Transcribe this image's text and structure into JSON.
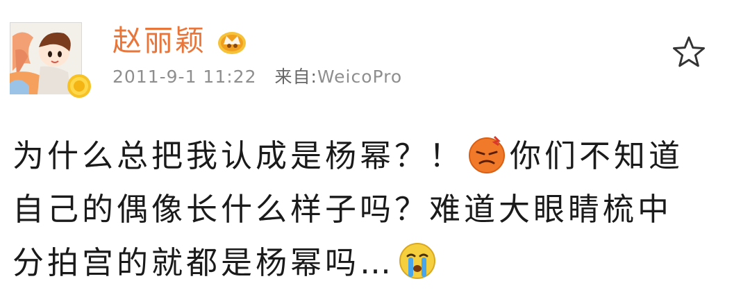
{
  "post": {
    "author": {
      "name": "赵丽颖",
      "avatar_icon": "cartoon-avatar-icon",
      "badge_icon": "vip-badge-icon",
      "member_icon": "member-crown-icon"
    },
    "meta": {
      "timestamp": "2011-9-1 11:22",
      "source_prefix": "来自:",
      "source_app": "WeicoPro"
    },
    "actions": {
      "favorite_icon": "star-icon"
    },
    "content": {
      "line1_a": "为什么总把我认成是杨幂？！",
      "line1_emoji": "angry-face-emoji",
      "line1_b": "你们不知道",
      "line2": "自己的偶像长什么样子吗？难道大眼睛梳中",
      "line3_a": "分拍宫的就都是杨幂吗…",
      "line3_emoji": "crying-face-emoji"
    },
    "colors": {
      "username": "#e8763a",
      "meta_text": "#8e8e8e",
      "body_text": "#1a1a1a"
    }
  }
}
